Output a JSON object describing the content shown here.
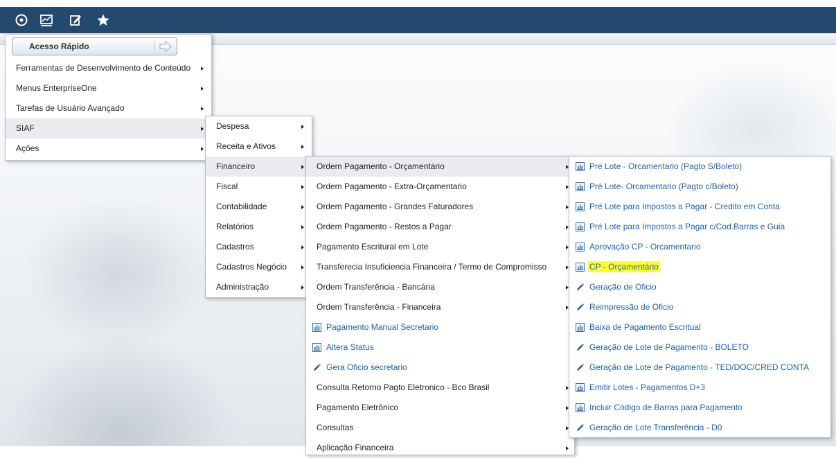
{
  "topbar": {
    "icons": [
      "recent-icon",
      "dashboard-icon",
      "edit-icon",
      "favorites-star-icon"
    ]
  },
  "quick_access": {
    "label": "Acesso Rápido",
    "button_icon": "arrow-right-icon"
  },
  "menu_level1": [
    {
      "label": "Ferramentas de Desenvolvimento de Conteúdo",
      "submenu": true
    },
    {
      "label": "Menus EnterpriseOne",
      "submenu": true
    },
    {
      "label": "Tarefas de Usuário Avançado",
      "submenu": true
    },
    {
      "label": "SIAF",
      "submenu": true,
      "selected": true
    },
    {
      "label": "Ações",
      "submenu": true
    }
  ],
  "menu_level2": [
    {
      "label": "Despesa",
      "submenu": true
    },
    {
      "label": "Receita e Ativos",
      "submenu": true
    },
    {
      "label": "Financeiro",
      "submenu": true,
      "selected": true
    },
    {
      "label": "Fiscal",
      "submenu": true
    },
    {
      "label": "Contabilidade",
      "submenu": true
    },
    {
      "label": "Relatórios",
      "submenu": true
    },
    {
      "label": "Cadastros",
      "submenu": true
    },
    {
      "label": "Cadastros Negócio",
      "submenu": true
    },
    {
      "label": "Administração",
      "submenu": true
    }
  ],
  "menu_level3": [
    {
      "label": "Ordem Pagamento - Orçamentário",
      "submenu": true,
      "selected": true
    },
    {
      "label": "Ordem Pagamento - Extra-Orçamentario",
      "submenu": true
    },
    {
      "label": "Ordem Pagamento - Grandes Faturadores",
      "submenu": true
    },
    {
      "label": "Ordem Pagamento - Restos a Pagar",
      "submenu": true
    },
    {
      "label": "Pagamento Escritural em Lote",
      "submenu": true
    },
    {
      "label": "Transferecia Insuficiencia Financeira / Termo de Compromisso",
      "submenu": true
    },
    {
      "label": "Ordem Transferência - Bancária",
      "submenu": true
    },
    {
      "label": "Ordem Transferência - Financeira",
      "submenu": true
    },
    {
      "label": "Pagamento Manual Secretario",
      "icon": "report-icon"
    },
    {
      "label": "Altera Status",
      "icon": "report-icon"
    },
    {
      "label": "Gera Oficio secretario",
      "icon": "pencil-icon"
    },
    {
      "label": "Consulta Retorno Pagto Eletronico - Bco Brasil",
      "submenu": true
    },
    {
      "label": "Pagamento Eletrônico",
      "submenu": true
    },
    {
      "label": "Consultas",
      "submenu": true
    },
    {
      "label": "Aplicação Financeira",
      "submenu": true
    }
  ],
  "menu_level4": [
    {
      "label": "Pré Lote - Orcamentario (Pagto S/Boleto)",
      "icon": "report-icon"
    },
    {
      "label": "Pré Lote- Orcamentario (Pagto c/Boleto)",
      "icon": "report-icon"
    },
    {
      "label": "Pré Lote para Impostos a Pagar - Credito em Conta",
      "icon": "report-icon"
    },
    {
      "label": "Pré Lote para Impostos a Pagar c/Cod.Barras e Guia",
      "icon": "report-icon"
    },
    {
      "label": "Aprovação CP - Orcamentario",
      "icon": "report-icon"
    },
    {
      "label": "CP - Orçamentário",
      "icon": "report-icon",
      "highlighted": true
    },
    {
      "label": "Geração de Oficio",
      "icon": "pencil-icon"
    },
    {
      "label": "Reimpressão de Oficio",
      "icon": "pencil-icon"
    },
    {
      "label": "Baixa de Pagamento Escritual",
      "icon": "report-icon"
    },
    {
      "label": "Geração de Lote de Pagamento - BOLETO",
      "icon": "pencil-icon"
    },
    {
      "label": "Geração de Lote de Pagamento - TED/DOC/CRED CONTA",
      "icon": "pencil-icon"
    },
    {
      "label": "Emitir Lotes - Pagamentos D+3",
      "icon": "report-icon"
    },
    {
      "label": "Incluir Código de Barras para Pagamento",
      "icon": "report-icon"
    },
    {
      "label": "Geração de Lote Transferência - D0",
      "icon": "pencil-icon"
    }
  ],
  "colors": {
    "topbar": "#234a6e",
    "link": "#1f5f9e",
    "highlight": "#ffff33",
    "selected_row": "#e9ebee"
  }
}
